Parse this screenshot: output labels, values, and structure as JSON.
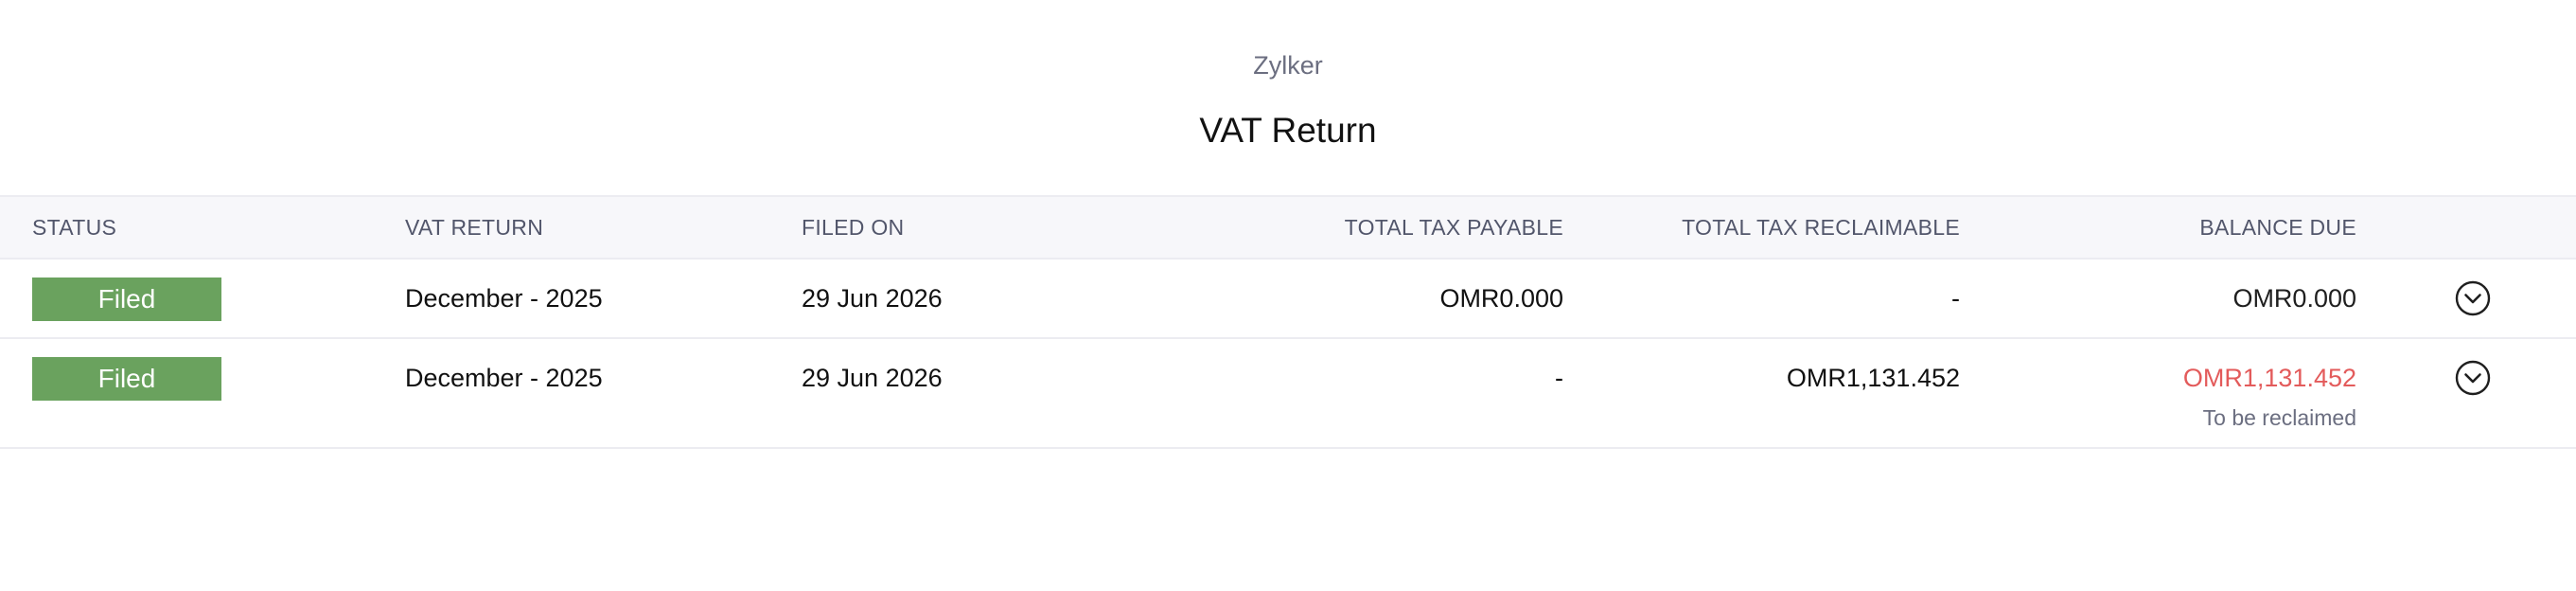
{
  "org_name": "Zylker",
  "report_title": "VAT Return",
  "columns": {
    "status": "STATUS",
    "vat_return": "VAT RETURN",
    "filed_on": "FILED ON",
    "total_tax_payable": "TOTAL TAX PAYABLE",
    "total_tax_reclaimable": "TOTAL TAX RECLAIMABLE",
    "balance_due": "BALANCE DUE"
  },
  "rows": [
    {
      "status": "Filed",
      "vat_return": "December - 2025",
      "filed_on": "29 Jun 2026",
      "total_tax_payable": "OMR0.000",
      "total_tax_reclaimable": "-",
      "balance_due": "OMR0.000",
      "balance_note": ""
    },
    {
      "status": "Filed",
      "vat_return": "December - 2025",
      "filed_on": "29 Jun 2026",
      "total_tax_payable": "-",
      "total_tax_reclaimable": "OMR1,131.452",
      "balance_due": "OMR1,131.452",
      "balance_note": "To be reclaimed"
    }
  ],
  "icons": {
    "expand": "chevron-down-circle-icon"
  },
  "colors": {
    "status_filed": "#6aa25e",
    "balance_negative": "#e35b5b",
    "header_bg": "#f7f7fa"
  }
}
